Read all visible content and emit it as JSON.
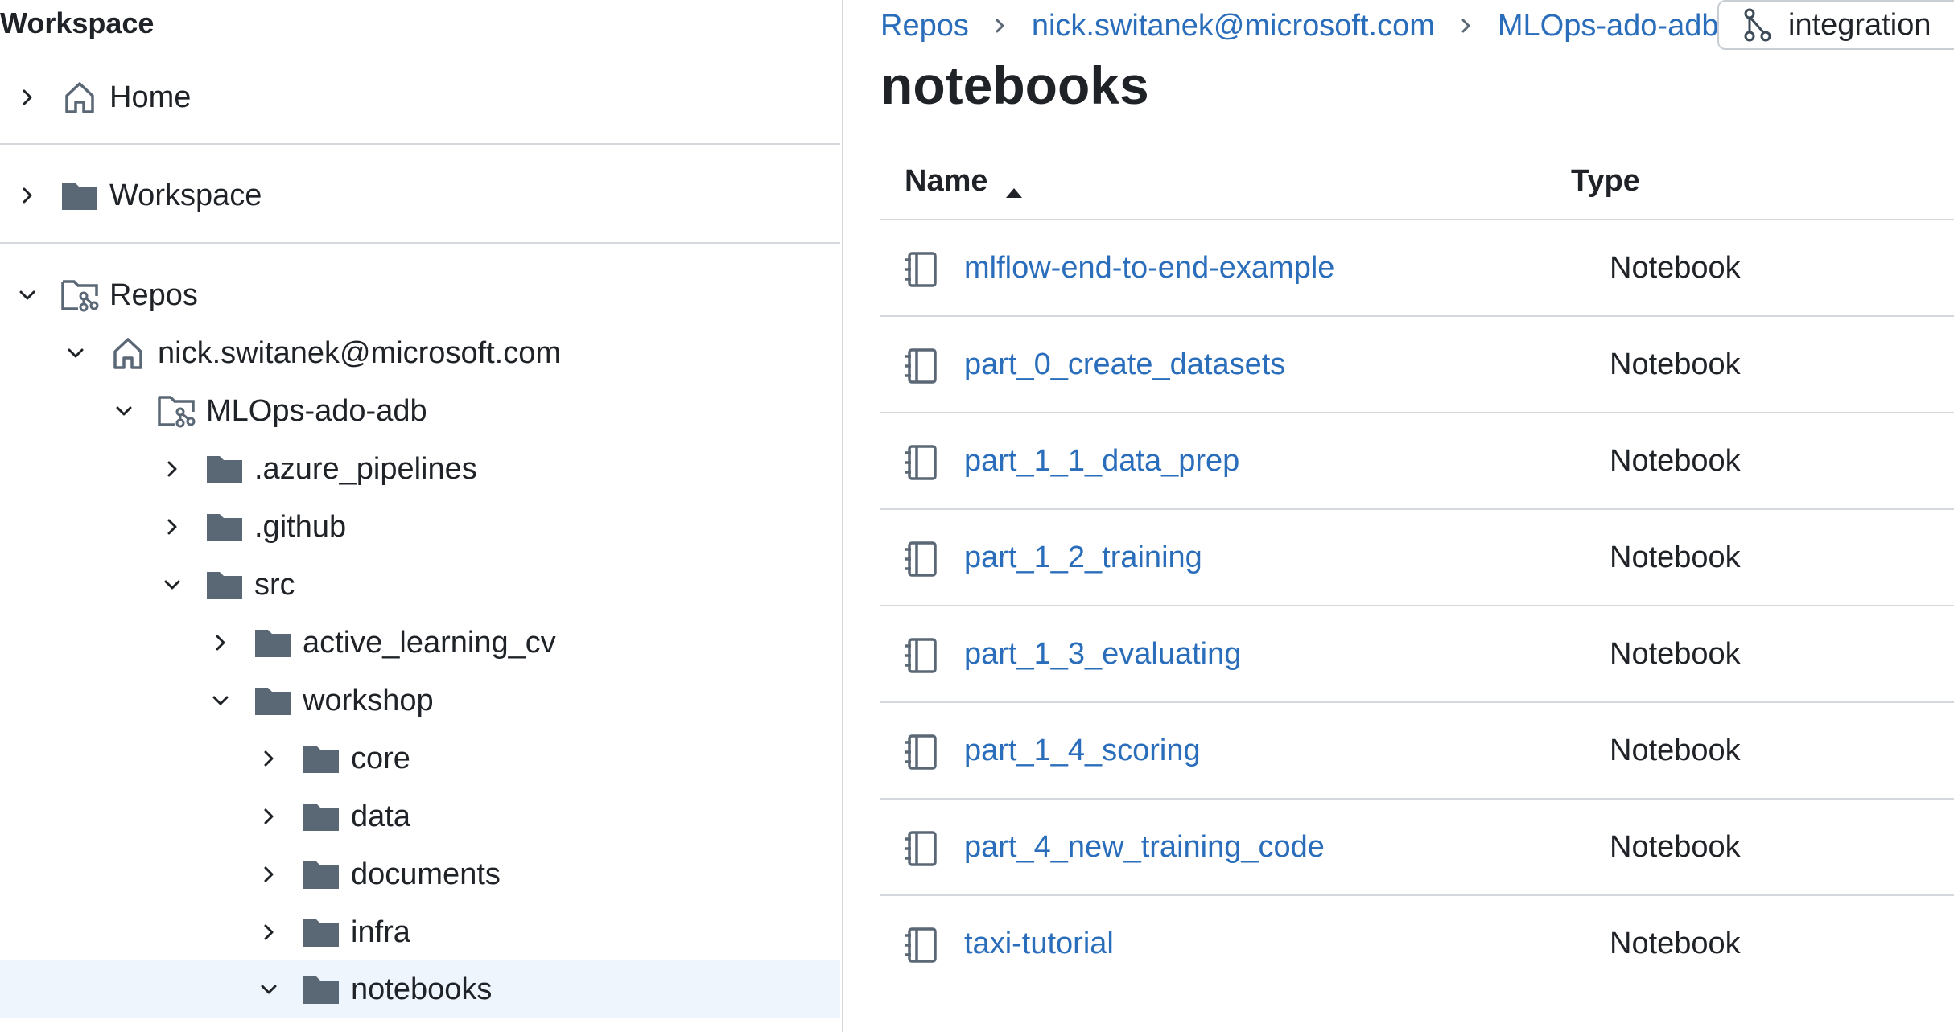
{
  "sidebar": {
    "title": "Workspace",
    "items": [
      {
        "label": "Home",
        "icon": "home-icon",
        "expanded": false,
        "selected": false
      },
      {
        "label": "Workspace",
        "icon": "folder-icon",
        "expanded": false,
        "selected": false
      },
      {
        "label": "Repos",
        "icon": "repo-icon",
        "expanded": true,
        "selected": false
      },
      {
        "label": "nick.switanek@microsoft.com",
        "icon": "home-icon",
        "expanded": true,
        "selected": false
      },
      {
        "label": "MLOps-ado-adb",
        "icon": "repo-icon",
        "expanded": true,
        "selected": false
      },
      {
        "label": ".azure_pipelines",
        "icon": "folder-icon",
        "expanded": false,
        "selected": false
      },
      {
        "label": ".github",
        "icon": "folder-icon",
        "expanded": false,
        "selected": false
      },
      {
        "label": "src",
        "icon": "folder-icon",
        "expanded": true,
        "selected": false
      },
      {
        "label": "active_learning_cv",
        "icon": "folder-icon",
        "expanded": false,
        "selected": false
      },
      {
        "label": "workshop",
        "icon": "folder-icon",
        "expanded": true,
        "selected": false
      },
      {
        "label": "core",
        "icon": "folder-icon",
        "expanded": false,
        "selected": false
      },
      {
        "label": "data",
        "icon": "folder-icon",
        "expanded": false,
        "selected": false
      },
      {
        "label": "documents",
        "icon": "folder-icon",
        "expanded": false,
        "selected": false
      },
      {
        "label": "infra",
        "icon": "folder-icon",
        "expanded": false,
        "selected": false
      },
      {
        "label": "notebooks",
        "icon": "folder-icon",
        "expanded": true,
        "selected": true
      }
    ]
  },
  "breadcrumb": {
    "items": [
      "Repos",
      "nick.switanek@microsoft.com",
      "MLOps-ado-adb"
    ],
    "branch": "integration",
    "branch_icon": "git-branch-icon"
  },
  "page": {
    "title": "notebooks"
  },
  "table": {
    "columns": {
      "name": "Name",
      "type": "Type"
    },
    "sort": "ascending",
    "rows": [
      {
        "name": "mlflow-end-to-end-example",
        "type": "Notebook"
      },
      {
        "name": "part_0_create_datasets",
        "type": "Notebook"
      },
      {
        "name": "part_1_1_data_prep",
        "type": "Notebook"
      },
      {
        "name": "part_1_2_training",
        "type": "Notebook"
      },
      {
        "name": "part_1_3_evaluating",
        "type": "Notebook"
      },
      {
        "name": "part_1_4_scoring",
        "type": "Notebook"
      },
      {
        "name": "part_4_new_training_code",
        "type": "Notebook"
      },
      {
        "name": "taxi-tutorial",
        "type": "Notebook"
      }
    ]
  },
  "colors": {
    "link": "#2a6ebb",
    "icon": "#5a6775",
    "selected_bg": "#eef5fc",
    "border": "#d4d8dc"
  }
}
